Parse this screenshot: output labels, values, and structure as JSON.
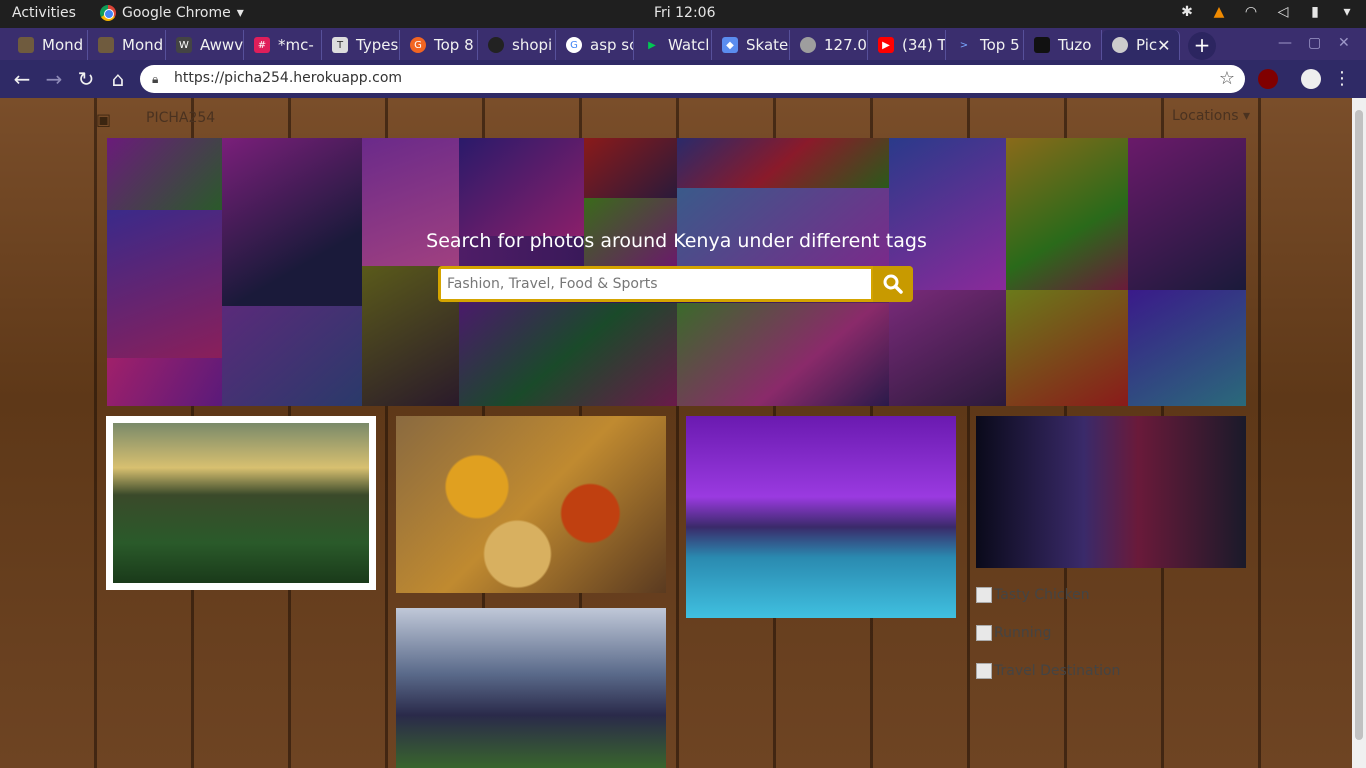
{
  "os_bar": {
    "activities": "Activities",
    "app_name": "Google Chrome",
    "clock": "Fri 12:06"
  },
  "tabs": [
    {
      "label": "Mond",
      "color": "#6f5b3e"
    },
    {
      "label": "Mond",
      "color": "#6f5b3e"
    },
    {
      "label": "Awwv",
      "color": "#444444"
    },
    {
      "label": "*mc-",
      "color": "#e01e5a"
    },
    {
      "label": "Types",
      "color": "#dddddd"
    },
    {
      "label": "Top 8",
      "color": "#f26522"
    },
    {
      "label": "shopi",
      "color": "#222222"
    },
    {
      "label": "asp sc",
      "color": "#4285f4"
    },
    {
      "label": "Watcl",
      "color": "#00c853"
    },
    {
      "label": "Skate",
      "color": "#5b8def"
    },
    {
      "label": "127.0",
      "color": "#9e9e9e"
    },
    {
      "label": "(34) T",
      "color": "#ff0000"
    },
    {
      "label": "Top 5",
      "color": "#3366cc"
    },
    {
      "label": "Tuzo",
      "color": "#111111"
    },
    {
      "label": "Pic",
      "color": "#cccccc",
      "active": true
    }
  ],
  "toolbar": {
    "url": "https://picha254.herokuapp.com"
  },
  "nav": {
    "brand": "PICHA254",
    "locations": "Locations"
  },
  "hero": {
    "heading": "Search for photos around Kenya under different tags",
    "search_placeholder": "Fashion, Travel, Food & Sports"
  },
  "gallery": {
    "broken_images": [
      "Tasty Chicken",
      "Running",
      "Travel Destination"
    ]
  },
  "colors": {
    "tabstrip": "#3a2e6e",
    "search_accent": "#d4a400"
  }
}
